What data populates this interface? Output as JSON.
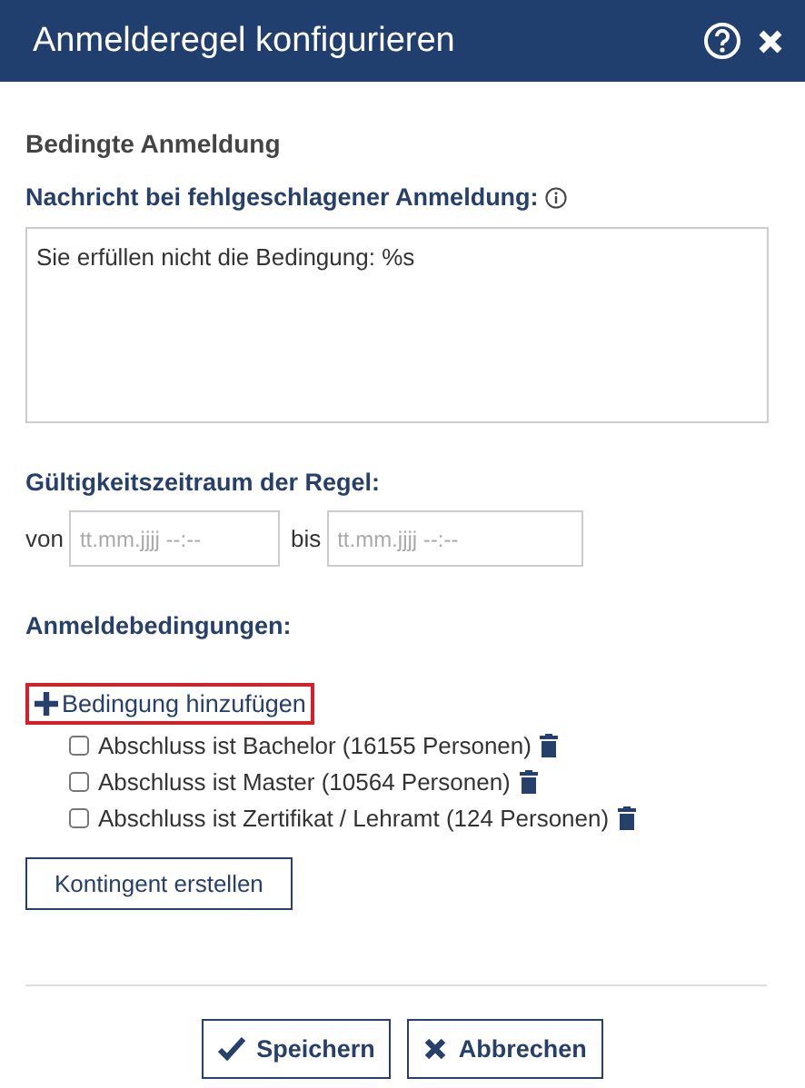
{
  "window": {
    "title": "Anmelderegel konfigurieren"
  },
  "section_title": "Bedingte Anmeldung",
  "message": {
    "label": "Nachricht bei fehlgeschlagener Anmeldung:",
    "value": "Sie erfüllen nicht die Bedingung: %s"
  },
  "validity": {
    "label": "Gültigkeitszeitraum der Regel:",
    "from_label": "von",
    "from_placeholder": "tt.mm.jjjj --:--",
    "to_label": "bis",
    "to_placeholder": "tt.mm.jjjj --:--"
  },
  "conditions": {
    "label": "Anmeldebedingungen:",
    "add_link": {
      "label": "Bedingung hinzufügen",
      "highlighted": true
    },
    "items": [
      {
        "label": "Abschluss ist Bachelor (16155 Personen)",
        "checked": false
      },
      {
        "label": "Abschluss ist Master (10564 Personen)",
        "checked": false
      },
      {
        "label": "Abschluss ist Zertifikat / Lehramt (124 Personen)",
        "checked": false
      }
    ]
  },
  "quota_button": "Kontingent erstellen",
  "buttons": [
    {
      "kind": "save",
      "label": "Speichern"
    },
    {
      "kind": "cancel",
      "label": "Abbrechen"
    }
  ]
}
